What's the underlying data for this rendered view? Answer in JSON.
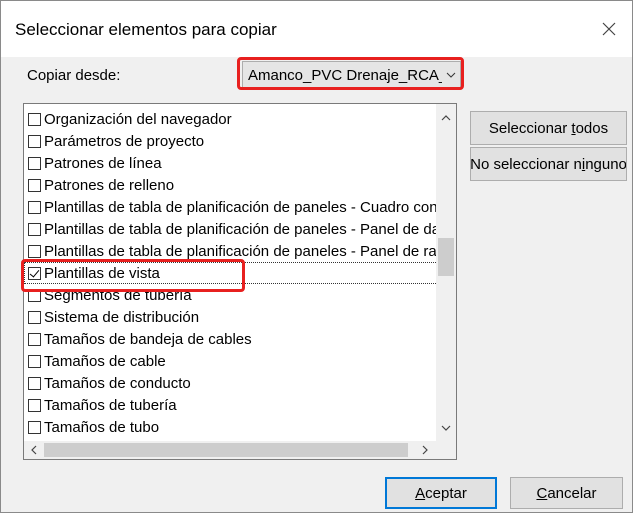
{
  "dialog": {
    "title": "Seleccionar elementos para copiar"
  },
  "source": {
    "label": "Copiar desde:",
    "value": "Amanco_PVC Drenaje_RCA_:"
  },
  "items": [
    {
      "label": "Organización del navegador",
      "checked": false
    },
    {
      "label": "Parámetros de proyecto",
      "checked": false
    },
    {
      "label": "Patrones de línea",
      "checked": false
    },
    {
      "label": "Patrones de relleno",
      "checked": false
    },
    {
      "label": "Plantillas de tabla de planificación de paneles - Cuadro con",
      "checked": false
    },
    {
      "label": "Plantillas de tabla de planificación de paneles - Panel de da",
      "checked": false
    },
    {
      "label": "Plantillas de tabla de planificación de paneles - Panel de ra",
      "checked": false
    },
    {
      "label": "Plantillas de vista",
      "checked": true,
      "selected": true
    },
    {
      "label": "Segmentos de tubería",
      "checked": false
    },
    {
      "label": "Sistema de distribución",
      "checked": false
    },
    {
      "label": "Tamaños de bandeja de cables",
      "checked": false
    },
    {
      "label": "Tamaños de cable",
      "checked": false
    },
    {
      "label": "Tamaños de conducto",
      "checked": false
    },
    {
      "label": "Tamaños de tubería",
      "checked": false
    },
    {
      "label": "Tamaños de tubo",
      "checked": false
    }
  ],
  "buttons": {
    "select_all_pre": "Seleccionar ",
    "select_all_key": "t",
    "select_all_post": "odos",
    "select_none_pre": "No seleccionar n",
    "select_none_key": "i",
    "select_none_post": "nguno",
    "ok_key": "A",
    "ok_post": "ceptar",
    "cancel_key": "C",
    "cancel_post": "ancelar"
  },
  "icons": {
    "close": "close-icon",
    "dropdown": "chevron-down-icon",
    "scroll_up": "chevron-up-icon",
    "scroll_down": "chevron-down-icon",
    "scroll_left": "chevron-left-icon",
    "scroll_right": "chevron-right-icon"
  },
  "colors": {
    "highlight": "#e8201f",
    "default_button_border": "#0078d7"
  }
}
